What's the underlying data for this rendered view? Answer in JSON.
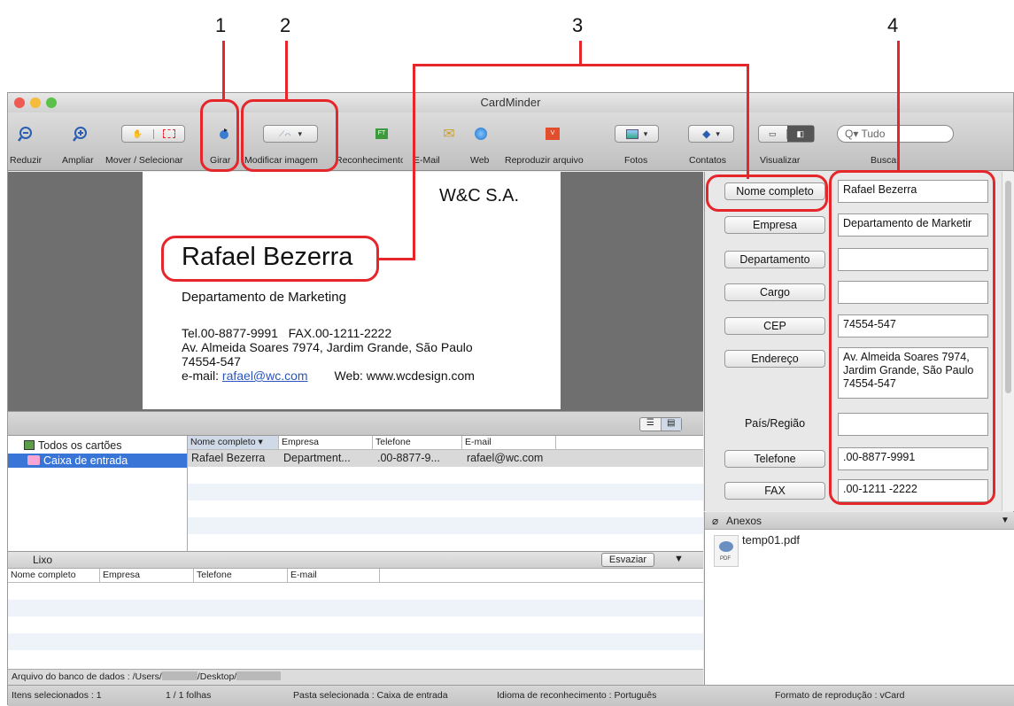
{
  "callouts": [
    "1",
    "2",
    "3",
    "4"
  ],
  "window": {
    "title": "CardMinder"
  },
  "toolbar": {
    "reduzir": "Reduzir",
    "ampliar": "Ampliar",
    "mover": "Mover / Selecionar",
    "girar": "Girar",
    "modificar": "Modificar imagem",
    "reconhecimento": "Reconhecimento",
    "email": "E-Mail",
    "web": "Web",
    "reproduzir": "Reproduzir arquivo",
    "fotos": "Fotos",
    "contatos": "Contatos",
    "visualizar": "Visualizar",
    "busca": "Busca",
    "search_placeholder": "Tudo"
  },
  "card": {
    "company": "W&C S.A.",
    "name": "Rafael Bezerra",
    "department": "Departamento de Marketing",
    "phones": "Tel.00-8877-9991   FAX.00-1211-2222",
    "address1": "Av. Almeida Soares 7974, Jardim Grande, São Paulo",
    "address2": "74554-547",
    "email_label": "e-mail:",
    "email": "rafael@wc.com",
    "web": "Web: www.wcdesign.com"
  },
  "tree": {
    "all_cards": "Todos os cartões",
    "inbox": "Caixa de entrada"
  },
  "list": {
    "columns": [
      "Nome completo",
      "Empresa",
      "Telefone",
      "E-mail"
    ],
    "row": [
      "Rafael Bezerra",
      "Department...",
      ".00-8877-9...",
      "rafael@wc.com"
    ]
  },
  "trash": {
    "title": "Lixo",
    "empty_button": "Esvaziar",
    "columns": [
      "Nome completo",
      "Empresa",
      "Telefone",
      "E-mail"
    ]
  },
  "db": {
    "text": "Arquivo do banco de dados : /Users/",
    "mid": "/Desktop/"
  },
  "status": {
    "selected": "Itens selecionados : 1",
    "pages": "1 / 1 folhas",
    "folder": "Pasta selecionada : Caixa de entrada",
    "language": "Idioma de reconhecimento : Português",
    "format": "Formato de reprodução : vCard"
  },
  "fields": {
    "nome_label": "Nome completo",
    "nome_value": "Rafael Bezerra",
    "empresa_label": "Empresa",
    "empresa_value": "Departamento de Marketir",
    "departamento_label": "Departamento",
    "departamento_value": "",
    "cargo_label": "Cargo",
    "cargo_value": "",
    "cep_label": "CEP",
    "cep_value": "74554-547",
    "endereco_label": "Endereço",
    "endereco_l1": "Av. Almeida Soares 7974,",
    "endereco_l2": "Jardim Grande, São Paulo",
    "endereco_l3": "74554-547",
    "pais_label": "País/Região",
    "pais_value": "",
    "telefone_label": "Telefone",
    "telefone_value": ".00-8877-9991",
    "fax_label": "FAX",
    "fax_value": ".00-1211 -2222"
  },
  "attachments": {
    "title": "Anexos",
    "file": "temp01.pdf",
    "pdf_badge": "PDF"
  },
  "colors": {
    "callout_red": "#e5262b",
    "selection": "#3875d7",
    "folder_pink": "#f7a6d3"
  }
}
